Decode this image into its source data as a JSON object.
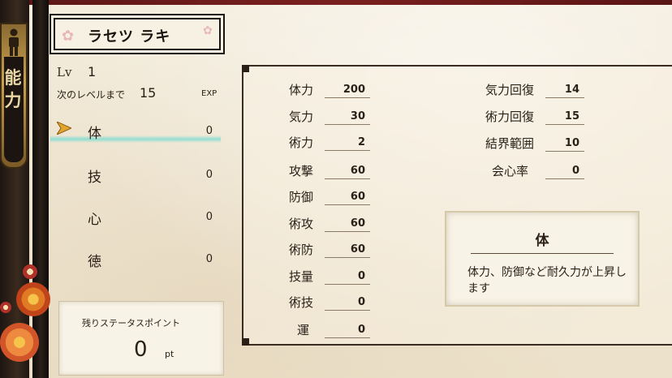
{
  "side_menu": {
    "label": "能力",
    "icon": "person-icon"
  },
  "character": {
    "name": "ラセツ ラキ"
  },
  "level": {
    "label": "Lv",
    "value": "1"
  },
  "next_level": {
    "label": "次のレベルまで",
    "value": "15",
    "unit": "EXP"
  },
  "allocation": [
    {
      "name": "体",
      "value": "0",
      "selected": true
    },
    {
      "name": "技",
      "value": "0",
      "selected": false
    },
    {
      "name": "心",
      "value": "0",
      "selected": false
    },
    {
      "name": "徳",
      "value": "0",
      "selected": false
    }
  ],
  "remaining_points": {
    "label": "残りステータスポイント",
    "value": "0",
    "unit": "pt"
  },
  "stats_left": [
    {
      "name": "体力",
      "value": "200"
    },
    {
      "name": "気力",
      "value": "30"
    },
    {
      "name": "術力",
      "value": "2"
    },
    {
      "name": "攻撃",
      "value": "60"
    },
    {
      "name": "防御",
      "value": "60"
    },
    {
      "name": "術攻",
      "value": "60"
    },
    {
      "name": "術防",
      "value": "60"
    },
    {
      "name": "技量",
      "value": "0"
    },
    {
      "name": "術技",
      "value": "0"
    },
    {
      "name": "運",
      "value": "0"
    }
  ],
  "stats_right": [
    {
      "name": "気力回復",
      "value": "14"
    },
    {
      "name": "術力回復",
      "value": "15"
    },
    {
      "name": "結界範囲",
      "value": "10"
    },
    {
      "name": "会心率",
      "value": "0"
    }
  ],
  "description": {
    "title": "体",
    "text": "体力、防御など耐久力が上昇します"
  },
  "colors": {
    "accent": "#82dcd2",
    "frame": "#2a2018",
    "gold": "#c9a24e"
  }
}
